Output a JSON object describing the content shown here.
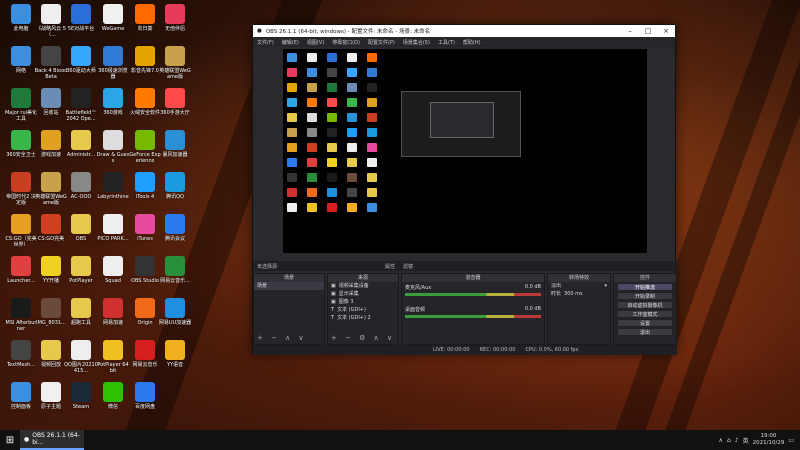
{
  "desktop": {
    "icons": [
      {
        "label": "此电脑",
        "color": "#3b8fe0"
      },
      {
        "label": "《战略风云 5（...",
        "color": "#eeeeee"
      },
      {
        "label": "5E对战平台",
        "color": "#2a6fd8"
      },
      {
        "label": "WeGame",
        "color": "#f0f0f0"
      },
      {
        "label": "向日葵",
        "color": "#ff6a00"
      },
      {
        "label": "无他伴侣",
        "color": "#e63b5a"
      },
      {
        "label": "网络",
        "color": "#3b8fe0"
      },
      {
        "label": "Back 4 Blood Beta",
        "color": "#444444"
      },
      {
        "label": "360驱动大师",
        "color": "#36a7ff"
      },
      {
        "label": "360极速浏览器",
        "color": "#2e7bd6"
      },
      {
        "label": "影音先锋7.0",
        "color": "#e6a400"
      },
      {
        "label": "英雄联盟WeGame版",
        "color": "#c8a24a"
      },
      {
        "label": "Major rui美化工具",
        "color": "#1d7a3a"
      },
      {
        "label": "回收站",
        "color": "#6b8cb5"
      },
      {
        "label": "Battlefield™ 2042 Ope...",
        "color": "#222222"
      },
      {
        "label": "360游戏",
        "color": "#2aa6e6"
      },
      {
        "label": "火绒安全软件",
        "color": "#ff7a00"
      },
      {
        "label": "360手游大厅",
        "color": "#ff4a4a"
      },
      {
        "label": "360安全卫士",
        "color": "#3ab54a"
      },
      {
        "label": "游戏加速",
        "color": "#e0a020"
      },
      {
        "label": "Administr...",
        "color": "#e6c84a"
      },
      {
        "label": "Draw & Guess",
        "color": "#dddddd"
      },
      {
        "label": "GeForce Experience",
        "color": "#76b900"
      },
      {
        "label": "暴风加速器",
        "color": "#2b8fd6"
      },
      {
        "label": "帝国时代2 决定版",
        "color": "#c84020"
      },
      {
        "label": "英雄联盟WeGame版",
        "color": "#c8a24a"
      },
      {
        "label": "AC-OOD",
        "color": "#888888"
      },
      {
        "label": "Labyrinthine",
        "color": "#222222"
      },
      {
        "label": "iTools 4",
        "color": "#1fa0ff"
      },
      {
        "label": "腾讯QQ",
        "color": "#1c9ae0"
      },
      {
        "label": "CS:GO（完美世界）",
        "color": "#e6a020"
      },
      {
        "label": "CS:GO完美",
        "color": "#d04020"
      },
      {
        "label": "OBS",
        "color": "#e6c84a"
      },
      {
        "label": "PICO PARK...",
        "color": "#eeeeee"
      },
      {
        "label": "iTunes",
        "color": "#e84aa0"
      },
      {
        "label": "腾讯会议",
        "color": "#2b7bf0"
      },
      {
        "label": "Launcher...",
        "color": "#e04040"
      },
      {
        "label": "YY开播",
        "color": "#f0d020"
      },
      {
        "label": "PotPlayer",
        "color": "#e6c84a"
      },
      {
        "label": "Squad",
        "color": "#eeeeee"
      },
      {
        "label": "OBS Studio",
        "color": "#333333"
      },
      {
        "label": "网易云音乐...",
        "color": "#2a8f3a"
      },
      {
        "label": "MSI Afterburner",
        "color": "#1a1a1a"
      },
      {
        "label": "IMG_8031...",
        "color": "#6a4a3a"
      },
      {
        "label": "超跑工具",
        "color": "#e6c84a"
      },
      {
        "label": "网易加速",
        "color": "#d03030"
      },
      {
        "label": "Origin",
        "color": "#f06a1a"
      },
      {
        "label": "网易UU加速器",
        "color": "#1f8fe0"
      },
      {
        "label": "TextMesh...",
        "color": "#444444"
      },
      {
        "label": "视频回放",
        "color": "#e6c84a"
      },
      {
        "label": "QQ图片20210415...",
        "color": "#eeeeee"
      },
      {
        "label": "PotPlayer 64 bit",
        "color": "#f0c020"
      },
      {
        "label": "网易云音乐",
        "color": "#d81e1e"
      },
      {
        "label": "YY语音",
        "color": "#f0b020"
      },
      {
        "label": "控制面板",
        "color": "#3b8fe0"
      },
      {
        "label": "原子主题",
        "color": "#f0f0f0"
      },
      {
        "label": "Steam",
        "color": "#1b2838"
      },
      {
        "label": "微信",
        "color": "#2dc100"
      },
      {
        "label": "百度网盘",
        "color": "#2a7bf0"
      }
    ]
  },
  "obs": {
    "title": "OBS 26.1.1 (64-bit, windows) - 配置文件: 未命名 - 场景: 未命名",
    "menu": [
      "文件(F)",
      "编辑(E)",
      "视图(V)",
      "停靠窗口(D)",
      "配置文件(P)",
      "场景集合(S)",
      "工具(T)",
      "帮助(H)"
    ],
    "scene_bar": {
      "label": "未选择源",
      "props": "属性",
      "filters": "滤镜"
    },
    "panels": {
      "scenes": {
        "title": "场景",
        "items": [
          "场景"
        ]
      },
      "sources": {
        "title": "来源",
        "items": [
          "视频采集设备",
          "显示采集",
          "图像 3",
          "文本 (GDI+)",
          "文本 (GDI+) 2"
        ]
      },
      "mixer": {
        "title": "混音器",
        "tracks": [
          {
            "name": "桌面音频",
            "db": "0.0 dB"
          },
          {
            "name": "麦克风/Aux",
            "db": "0.0 dB"
          }
        ]
      },
      "transitions": {
        "title": "转场特效",
        "type": "淡出",
        "duration_label": "时长",
        "duration": "300 ms"
      },
      "controls": {
        "title": "控件",
        "buttons": [
          "开始推流",
          "开始录制",
          "启动虚拟摄像机",
          "工作室模式",
          "设置",
          "退出"
        ]
      }
    },
    "status": {
      "live": "LIVE: 00:00:00",
      "rec": "REC: 00:00:00",
      "cpu": "CPU: 0.0%, 60.00 fps"
    }
  },
  "taskbar": {
    "task_label": "OBS 26.1.1 (64-bi...",
    "lang": "英",
    "time": "19:00",
    "date": "2021/10/29"
  }
}
